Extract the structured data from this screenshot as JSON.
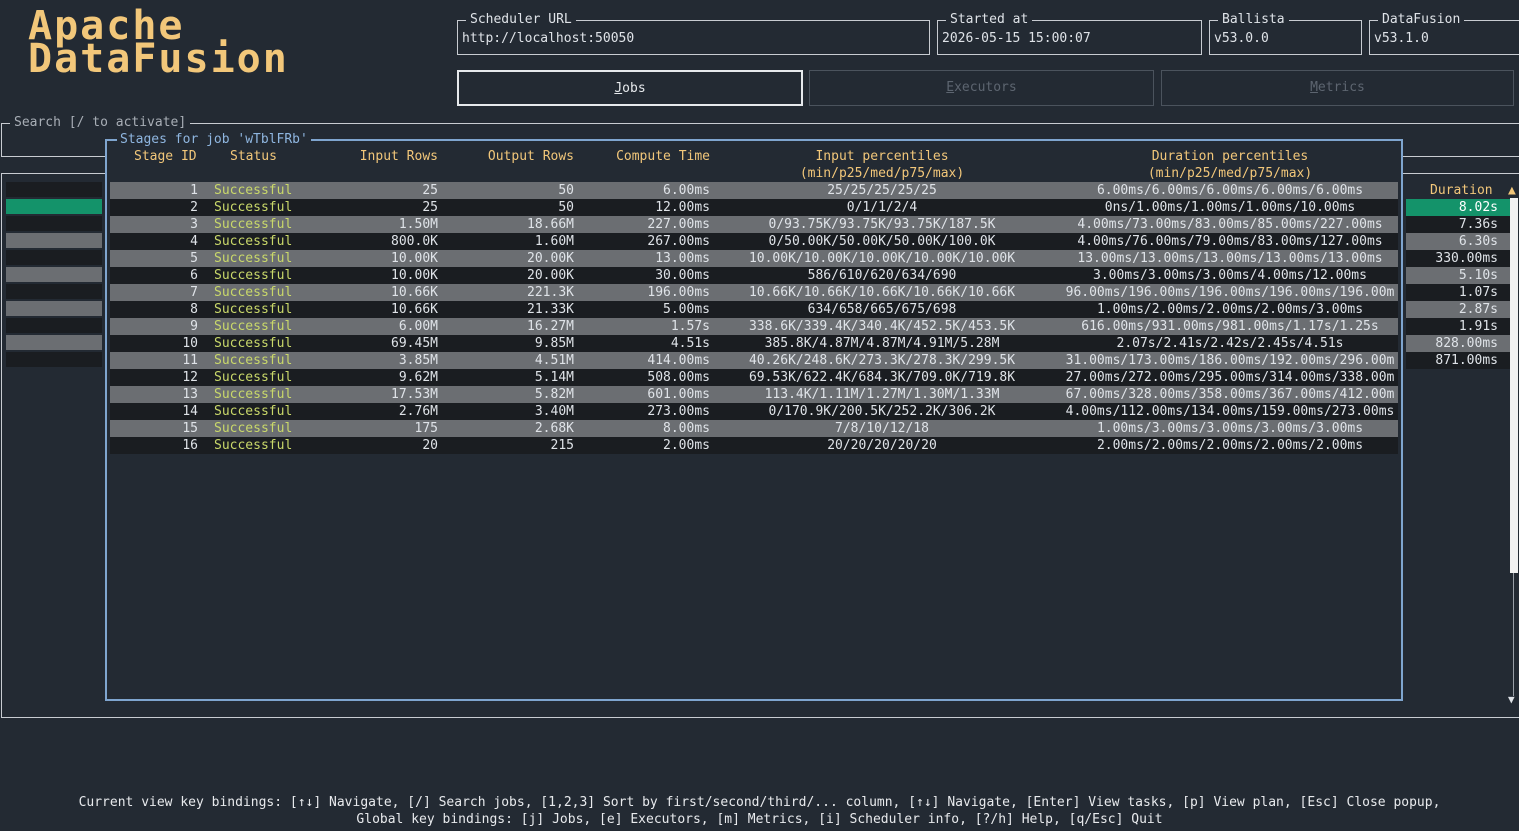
{
  "logo": {
    "line1": "Apache",
    "line2": "DataFusion"
  },
  "info": {
    "scheduler_url_label": "Scheduler URL",
    "scheduler_url": "http://localhost:50050",
    "started_at_label": "Started at",
    "started_at": "2026-05-15 15:00:07",
    "ballista_label": "Ballista",
    "ballista": "v53.0.0",
    "datafusion_label": "DataFusion",
    "datafusion": "v53.1.0"
  },
  "tabs": [
    {
      "hotkey": "J",
      "rest": "obs",
      "active": true
    },
    {
      "hotkey": "E",
      "rest": "xecutors",
      "active": false
    },
    {
      "hotkey": "M",
      "rest": "etrics",
      "active": false
    }
  ],
  "search": {
    "label": "Search [/ to activate]"
  },
  "jobs_table": {
    "duration_header": "Duration",
    "sort_indicator": "▲",
    "durations": [
      "8.02s",
      "7.36s",
      "6.30s",
      "330.00ms",
      "5.10s",
      "1.07s",
      "2.87s",
      "1.91s",
      "828.00ms",
      "871.00ms"
    ]
  },
  "popup": {
    "title": "Stages for job 'wTblFRb'",
    "headers": {
      "stage_id": "Stage ID",
      "status": "Status",
      "input_rows": "Input Rows",
      "output_rows": "Output Rows",
      "compute_time": "Compute Time",
      "input_percentiles": "Input percentiles",
      "duration_percentiles": "Duration percentiles",
      "percentile_sub": "(min/p25/med/p75/max)"
    },
    "rows": [
      [
        "1",
        "Successful",
        "25",
        "50",
        "6.00ms",
        "25/25/25/25/25",
        "6.00ms/6.00ms/6.00ms/6.00ms/6.00ms"
      ],
      [
        "2",
        "Successful",
        "25",
        "50",
        "12.00ms",
        "0/1/1/2/4",
        "0ns/1.00ms/1.00ms/1.00ms/10.00ms"
      ],
      [
        "3",
        "Successful",
        "1.50M",
        "18.66M",
        "227.00ms",
        "0/93.75K/93.75K/93.75K/187.5K",
        "4.00ms/73.00ms/83.00ms/85.00ms/227.00ms"
      ],
      [
        "4",
        "Successful",
        "800.0K",
        "1.60M",
        "267.00ms",
        "0/50.00K/50.00K/50.00K/100.0K",
        "4.00ms/76.00ms/79.00ms/83.00ms/127.00ms"
      ],
      [
        "5",
        "Successful",
        "10.00K",
        "20.00K",
        "13.00ms",
        "10.00K/10.00K/10.00K/10.00K/10.00K",
        "13.00ms/13.00ms/13.00ms/13.00ms/13.00ms"
      ],
      [
        "6",
        "Successful",
        "10.00K",
        "20.00K",
        "30.00ms",
        "586/610/620/634/690",
        "3.00ms/3.00ms/3.00ms/4.00ms/12.00ms"
      ],
      [
        "7",
        "Successful",
        "10.66K",
        "221.3K",
        "196.00ms",
        "10.66K/10.66K/10.66K/10.66K/10.66K",
        "96.00ms/196.00ms/196.00ms/196.00ms/196.00m"
      ],
      [
        "8",
        "Successful",
        "10.66K",
        "21.33K",
        "5.00ms",
        "634/658/665/675/698",
        "1.00ms/2.00ms/2.00ms/2.00ms/3.00ms"
      ],
      [
        "9",
        "Successful",
        "6.00M",
        "16.27M",
        "1.57s",
        "338.6K/339.4K/340.4K/452.5K/453.5K",
        "616.00ms/931.00ms/981.00ms/1.17s/1.25s"
      ],
      [
        "10",
        "Successful",
        "69.45M",
        "9.85M",
        "4.51s",
        "385.8K/4.87M/4.87M/4.91M/5.28M",
        "2.07s/2.41s/2.42s/2.45s/4.51s"
      ],
      [
        "11",
        "Successful",
        "3.85M",
        "4.51M",
        "414.00ms",
        "40.26K/248.6K/273.3K/278.3K/299.5K",
        "31.00ms/173.00ms/186.00ms/192.00ms/296.00m"
      ],
      [
        "12",
        "Successful",
        "9.62M",
        "5.14M",
        "508.00ms",
        "69.53K/622.4K/684.3K/709.0K/719.8K",
        "27.00ms/272.00ms/295.00ms/314.00ms/338.00m"
      ],
      [
        "13",
        "Successful",
        "17.53M",
        "5.82M",
        "601.00ms",
        "113.4K/1.11M/1.27M/1.30M/1.33M",
        "67.00ms/328.00ms/358.00ms/367.00ms/412.00m"
      ],
      [
        "14",
        "Successful",
        "2.76M",
        "3.40M",
        "273.00ms",
        "0/170.9K/200.5K/252.2K/306.2K",
        "4.00ms/112.00ms/134.00ms/159.00ms/273.00ms"
      ],
      [
        "15",
        "Successful",
        "175",
        "2.68K",
        "8.00ms",
        "7/8/10/12/18",
        "1.00ms/3.00ms/3.00ms/3.00ms/3.00ms"
      ],
      [
        "16",
        "Successful",
        "20",
        "215",
        "2.00ms",
        "20/20/20/20/20",
        "2.00ms/2.00ms/2.00ms/2.00ms/2.00ms"
      ]
    ]
  },
  "scrollbar": {
    "up": "▲",
    "down": "▼"
  },
  "footer": {
    "line1": "Current view key bindings: [↑↓] Navigate, [/] Search jobs, [1,2,3] Sort by first/second/third/... column, [↑↓] Navigate, [Enter] View tasks, [p] View plan, [Esc] Close popup,",
    "line2": "Global key bindings: [j] Jobs, [e] Executors, [m] Metrics, [i] Scheduler info, [?/h] Help, [q/Esc] Quit"
  },
  "colors": {
    "accent": "#f2c77a",
    "selected": "#14936a",
    "status": "#c9d86a",
    "popup_border": "#7fa5cf"
  }
}
